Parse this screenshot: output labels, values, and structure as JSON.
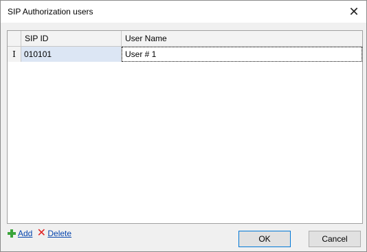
{
  "window": {
    "title": "SIP Authorization users",
    "close_glyph": "✕"
  },
  "grid": {
    "columns": [
      "SIP ID",
      "User Name"
    ],
    "rows": [
      {
        "indicator": "I",
        "sip_id": "010101",
        "user_name": "User # 1"
      }
    ]
  },
  "toolbar": {
    "add_label": "Add",
    "delete_label": "Delete"
  },
  "buttons": {
    "ok": "OK",
    "cancel": "Cancel"
  },
  "icons": {
    "add": "plus-icon",
    "delete": "x-icon",
    "close": "close-icon"
  },
  "colors": {
    "selected_cell": "#dce6f4",
    "link": "#0645ad",
    "add_icon": "#3aa43a",
    "delete_icon": "#e02020"
  }
}
